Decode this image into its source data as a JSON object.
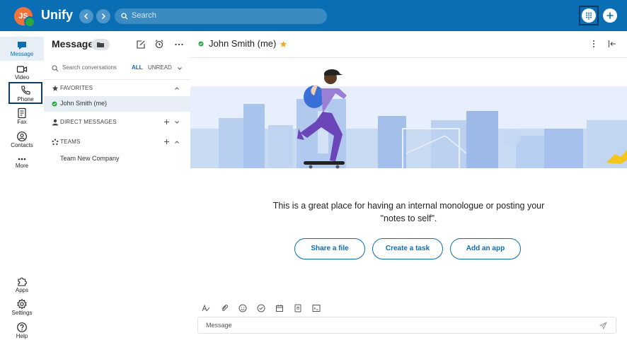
{
  "topbar": {
    "avatar_initials": "JS",
    "brand": "Unify",
    "search_placeholder": "Search"
  },
  "rail": {
    "top_items": [
      {
        "label": "Message",
        "icon": "chat-bubble-icon"
      },
      {
        "label": "Video",
        "icon": "video-camera-icon"
      },
      {
        "label": "Phone",
        "icon": "phone-icon"
      },
      {
        "label": "Fax",
        "icon": "fax-icon"
      },
      {
        "label": "Contacts",
        "icon": "contacts-icon"
      },
      {
        "label": "More",
        "icon": "more-dots-icon"
      }
    ],
    "bottom_items": [
      {
        "label": "Apps",
        "icon": "puzzle-icon"
      },
      {
        "label": "Settings",
        "icon": "gear-icon"
      },
      {
        "label": "Help",
        "icon": "help-icon"
      }
    ]
  },
  "panel": {
    "title": "Message",
    "search_placeholder": "Search conversations",
    "filter_all": "ALL",
    "filter_unread": "UNREAD",
    "favorites_label": "FAVORITES",
    "favorite_contact": "John Smith (me)",
    "direct_label": "DIRECT MESSAGES",
    "teams_label": "TEAMS",
    "team_item": "Team New Company"
  },
  "main": {
    "title": "John Smith (me)",
    "prompt_line1": "This is a great place for having an internal monologue or posting your",
    "prompt_line2": "\"notes to self\".",
    "share_file": "Share a file",
    "create_task": "Create a task",
    "add_app": "Add an app",
    "composer_placeholder": "Message"
  },
  "colors": {
    "brand_blue": "#0a6eb5",
    "avatar": "#f0733a",
    "presence": "#28a745",
    "star": "#f5a623"
  }
}
